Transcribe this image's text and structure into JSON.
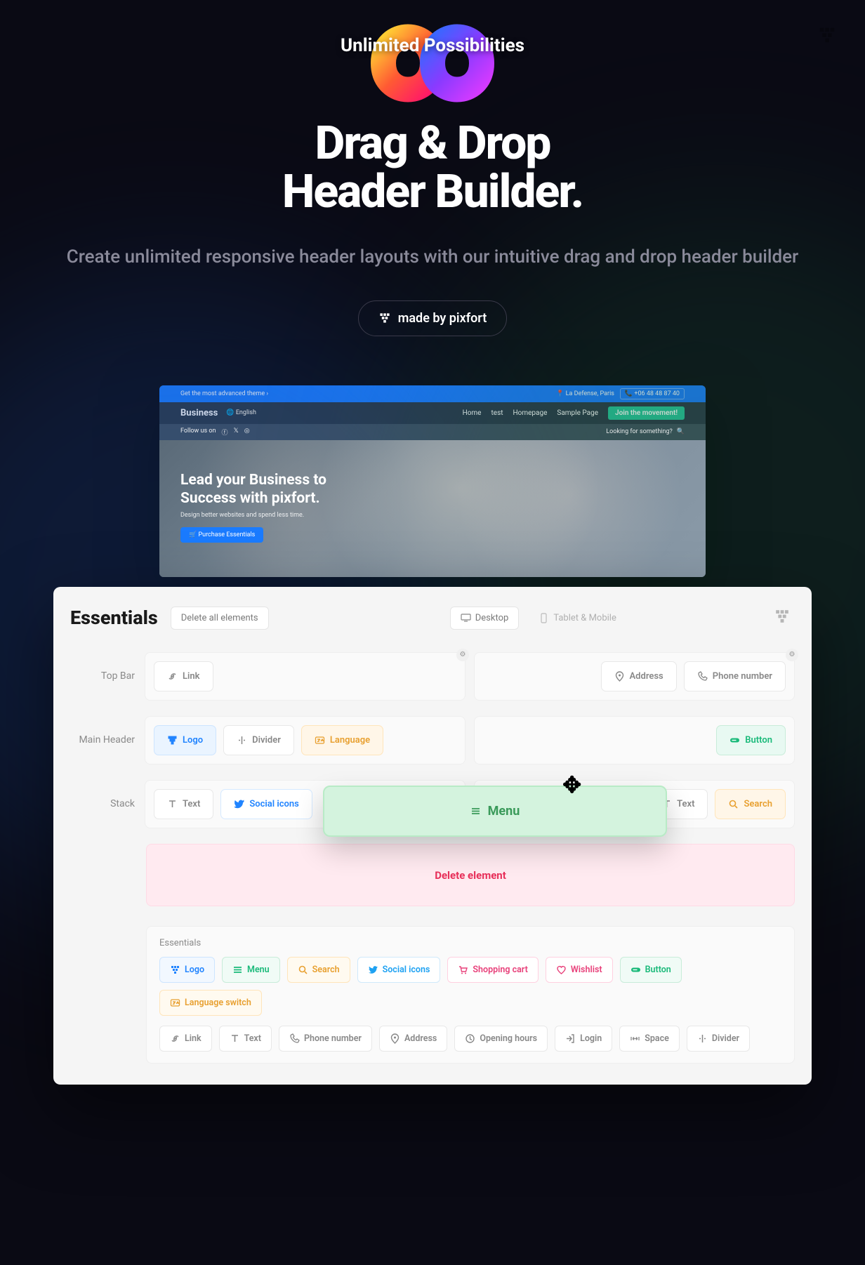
{
  "hero": {
    "badge": "Unlimited Possibilities",
    "title_line1": "Drag & Drop",
    "title_line2": "Header Builder.",
    "subtitle": "Create unlimited responsive header layouts with our intuitive drag and drop header builder",
    "made_by": "made by pixfort"
  },
  "preview": {
    "topbar": {
      "left": "Get the most advanced theme ›",
      "address": "La Defense, Paris",
      "phone": "+06 48 48 87 40"
    },
    "nav": {
      "brand": "Business",
      "language": "English",
      "items": [
        "Home",
        "test",
        "Homepage",
        "Sample Page"
      ],
      "cta": "Join the movement!"
    },
    "subnav": {
      "follow": "Follow us on",
      "search": "Looking for something?"
    },
    "hero_section": {
      "title_line1": "Lead your Business to",
      "title_line2": "Success with pixfort.",
      "subtitle": "Design better websites and spend less time.",
      "button": "Purchase Essentials"
    }
  },
  "builder": {
    "title": "Essentials",
    "delete_all": "Delete all elements",
    "views": {
      "desktop": "Desktop",
      "mobile": "Tablet & Mobile"
    },
    "rows": {
      "topbar": {
        "label": "Top Bar",
        "left": [
          {
            "label": "Link",
            "icon": "link"
          }
        ],
        "right": [
          {
            "label": "Address",
            "icon": "pin"
          },
          {
            "label": "Phone number",
            "icon": "phone"
          }
        ]
      },
      "main": {
        "label": "Main Header",
        "left": [
          {
            "label": "Logo",
            "icon": "tower",
            "variant": "blue"
          },
          {
            "label": "Divider",
            "icon": "divider"
          },
          {
            "label": "Language",
            "icon": "lang",
            "variant": "amber"
          }
        ],
        "right": [
          {
            "label": "Button",
            "icon": "btn",
            "variant": "green"
          }
        ]
      },
      "stack": {
        "label": "Stack",
        "left": [
          {
            "label": "Text",
            "icon": "text"
          },
          {
            "label": "Social icons",
            "icon": "twitter",
            "variant": "hasblue"
          }
        ],
        "right": [
          {
            "label": "Text",
            "icon": "text"
          },
          {
            "label": "Search",
            "icon": "search",
            "variant": "amber"
          }
        ]
      }
    },
    "dragging": {
      "label": "Menu"
    },
    "delete_zone": "Delete element",
    "palette": {
      "title": "Essentials",
      "row1": [
        {
          "label": "Logo",
          "icon": "tower",
          "variant": "blue"
        },
        {
          "label": "Menu",
          "icon": "menu",
          "variant": "green"
        },
        {
          "label": "Search",
          "icon": "search",
          "variant": "amber"
        },
        {
          "label": "Social icons",
          "icon": "twitter",
          "variant": "tw"
        },
        {
          "label": "Shopping cart",
          "icon": "cart",
          "variant": "pink"
        },
        {
          "label": "Wishlist",
          "icon": "heart",
          "variant": "pink"
        },
        {
          "label": "Button",
          "icon": "btn",
          "variant": "green"
        },
        {
          "label": "Language switch",
          "icon": "lang",
          "variant": "amber"
        }
      ],
      "row2": [
        {
          "label": "Link",
          "icon": "link"
        },
        {
          "label": "Text",
          "icon": "text"
        },
        {
          "label": "Phone number",
          "icon": "phone"
        },
        {
          "label": "Address",
          "icon": "pin"
        },
        {
          "label": "Opening hours",
          "icon": "clock"
        },
        {
          "label": "Login",
          "icon": "login"
        },
        {
          "label": "Space",
          "icon": "space"
        },
        {
          "label": "Divider",
          "icon": "divider"
        }
      ]
    }
  }
}
